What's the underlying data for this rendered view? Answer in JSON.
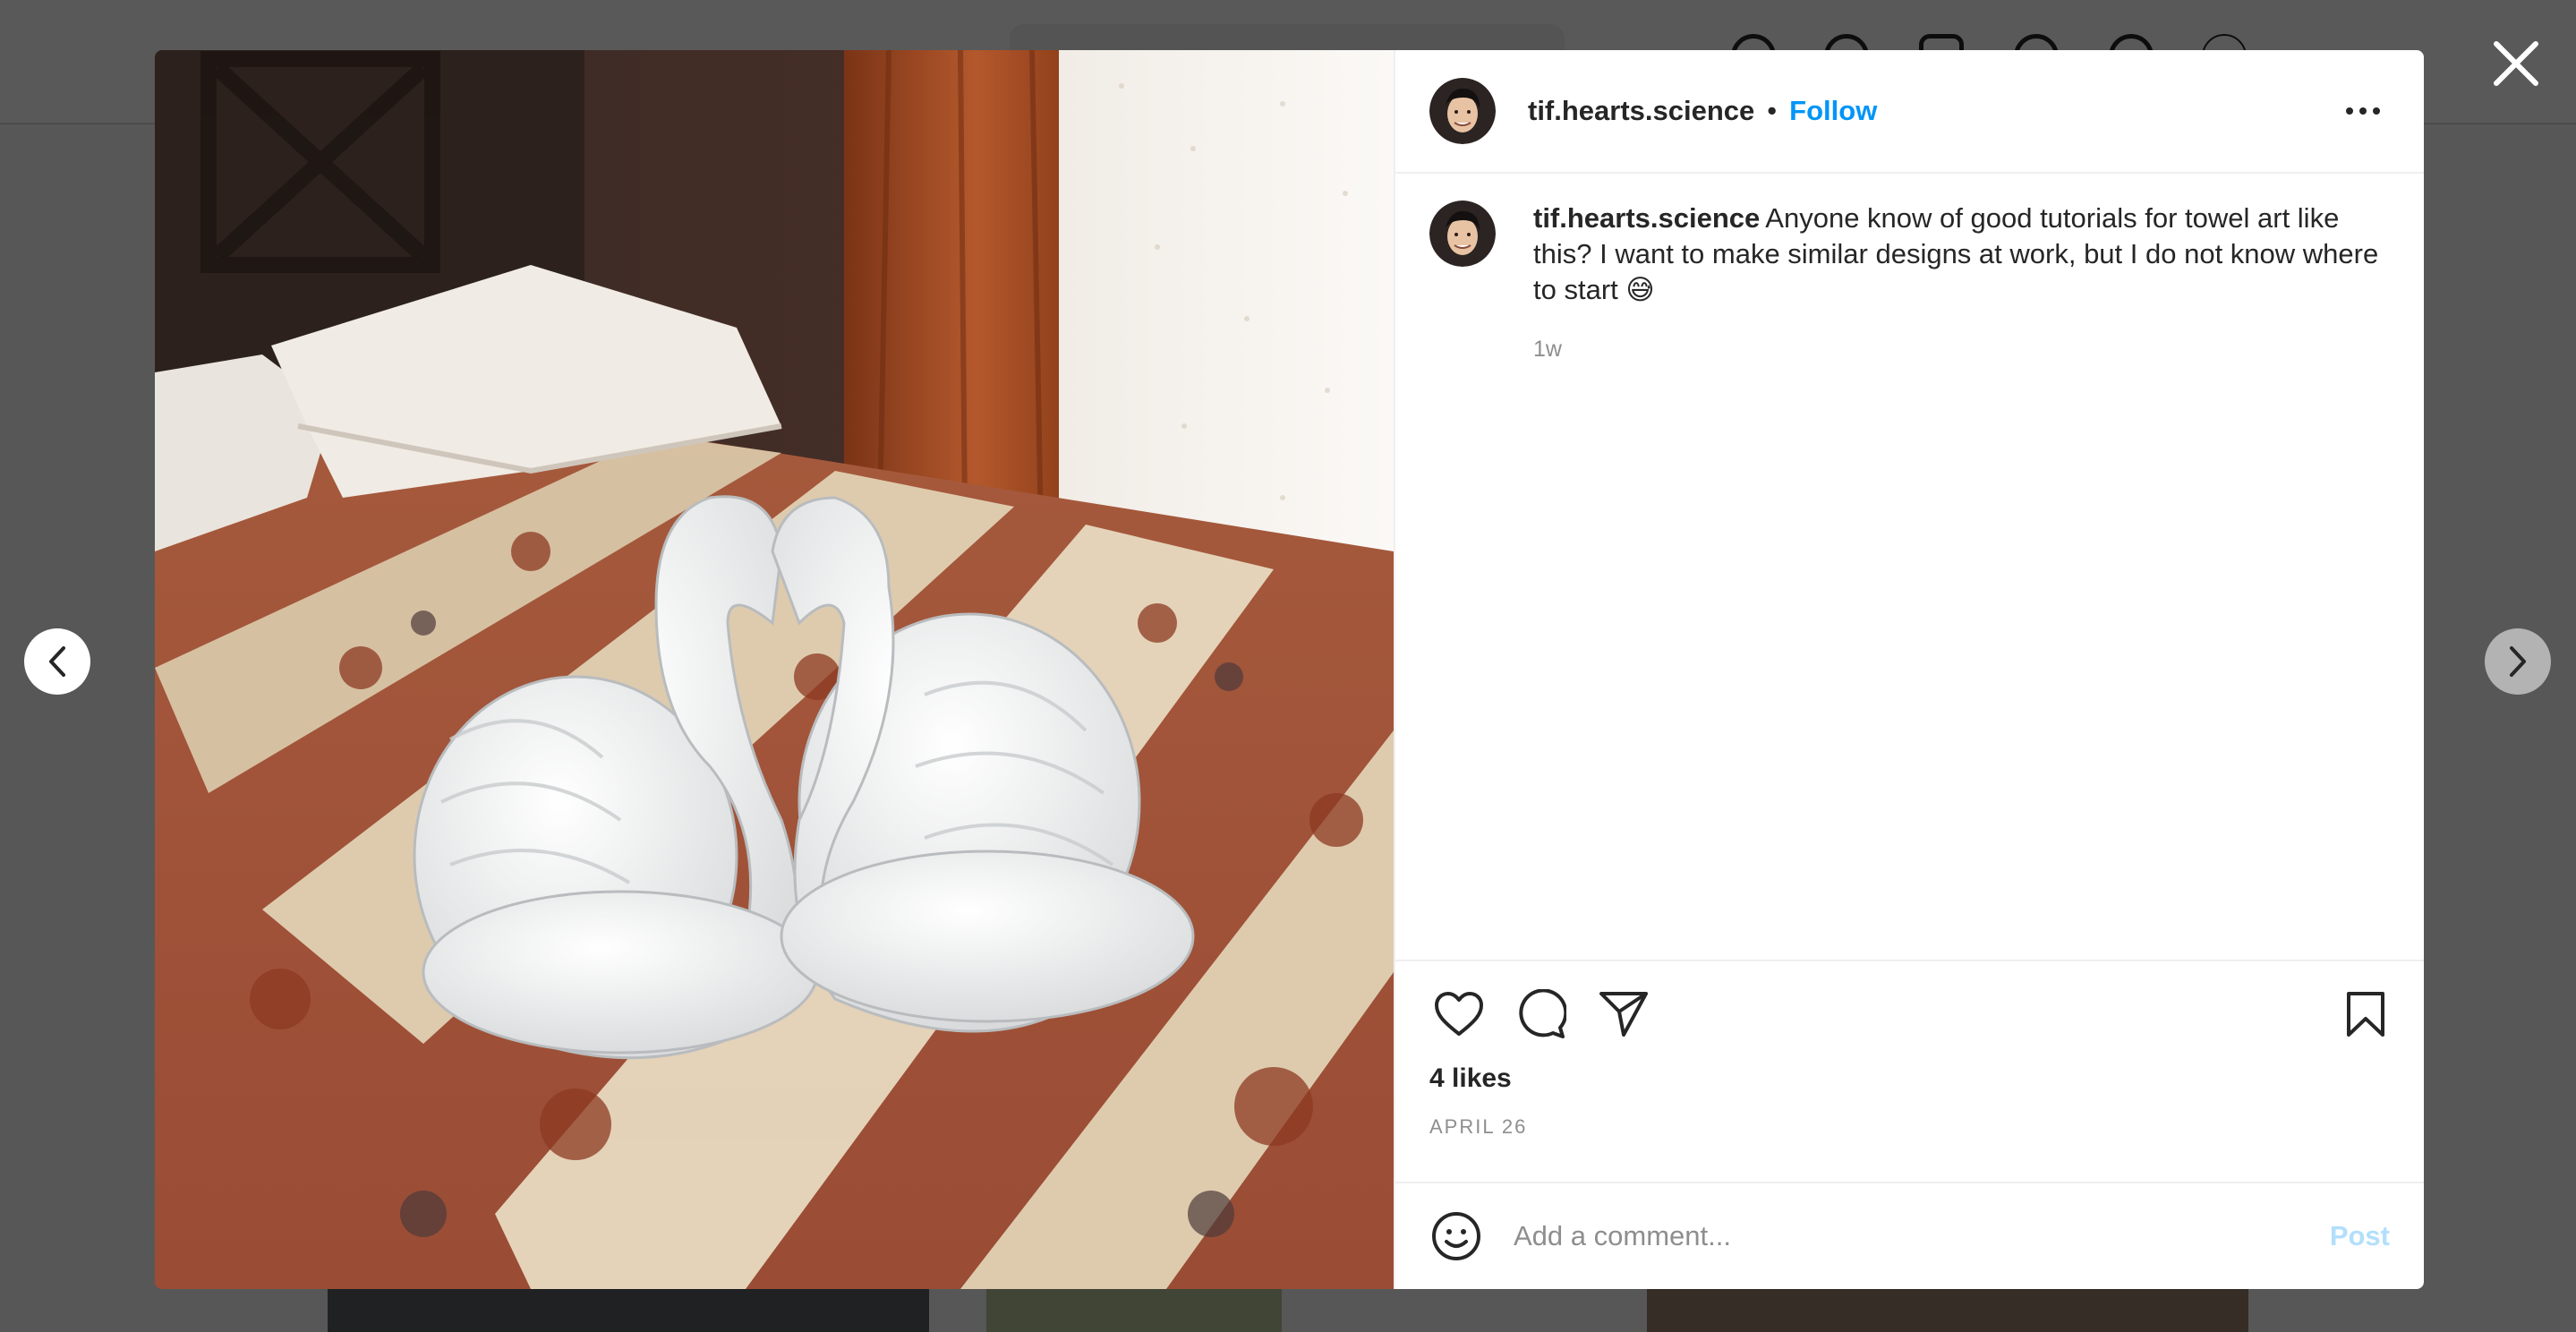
{
  "post": {
    "username": "tif.hearts.science",
    "separator": "•",
    "follow_label": "Follow",
    "caption_user": "tif.hearts.science",
    "caption_text": "Anyone know of good tutorials for towel art like this? I want to make similar designs at work, but I do not know where to start 😅",
    "time_ago": "1w",
    "likes": "4 likes",
    "date": "APRIL 26"
  },
  "comment_box": {
    "placeholder": "Add a comment...",
    "post_label": "Post"
  },
  "colors": {
    "link_blue": "#0095f6",
    "post_disabled": "#b2dffc",
    "secondary_text": "#8e8e8e"
  },
  "icons": {
    "close": "close-icon",
    "more": "more-options-icon",
    "like": "heart-icon",
    "comment": "comment-bubble-icon",
    "share": "paper-plane-icon",
    "save": "bookmark-icon",
    "emoji": "smiley-icon",
    "prev": "chevron-left-icon",
    "next": "chevron-right-icon"
  }
}
